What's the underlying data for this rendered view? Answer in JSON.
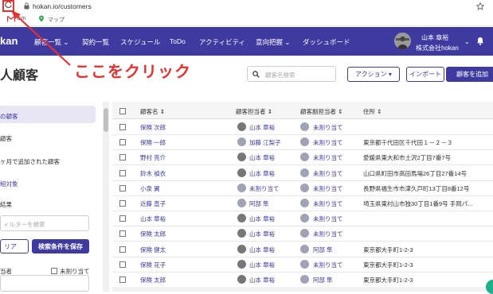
{
  "browser": {
    "url": "hokan.io/customers",
    "bookmarks": [
      {
        "label": "Gm"
      },
      {
        "label": "マップ"
      }
    ]
  },
  "annotation": {
    "text": "ここをクリック"
  },
  "nav": {
    "brand": "kan",
    "items": [
      "顧客一覧 ⌄",
      "契約一覧",
      "スケジュール",
      "ToDo",
      "アクティビティ",
      "意向把握 ⌄",
      "ダッシュボード"
    ],
    "user_name": "山本 章裕",
    "user_org": "株式会社hokan",
    "user_chevron": "⌄"
  },
  "page": {
    "title": "人顧客",
    "search_placeholder": "顧客名検索",
    "action_button": "アクション ▾",
    "import_button": "インポート",
    "add_button": "顧客を追加"
  },
  "left_panel": {
    "item_active": "の顧客",
    "item_2": "顧客",
    "item_3": "ヶ月で追加された顧客",
    "section_link": "組対象",
    "section_results": "結果",
    "filter_placeholder": "ィルターを検索",
    "clear_button": "リア",
    "save_button": "検索条件を保存",
    "assignee_label": "当者",
    "unassigned_label": "未割り当て"
  },
  "table": {
    "headers": [
      "顧客名 ⇕",
      "顧客担当者 ⇕",
      "顧客副担当者 ⇕",
      "住所 ⇕"
    ],
    "rows": [
      {
        "name": "保険 次郎",
        "main": "山本 章裕",
        "main_avatar": "photo",
        "sub": "未割り当て",
        "address": ""
      },
      {
        "name": "保険 一郎",
        "main": "加藤 江梨子",
        "main_avatar": "ghost",
        "sub": "未割り当て",
        "address": "東京都千代田区千代田１－２－３"
      },
      {
        "name": "野村 亮介",
        "main": "山本 章裕",
        "main_avatar": "photo",
        "sub": "未割り当て",
        "address": "愛媛県東大和市土沢2丁目7番7号"
      },
      {
        "name": "鈴木 禎衣",
        "main": "山本 章裕",
        "main_avatar": "photo",
        "sub": "未割り当て",
        "address": "山口県町田市高田馬場26丁目27番14号"
      },
      {
        "name": "小泉 翼",
        "main": "未割り当て",
        "main_avatar": "ghost",
        "sub": "未割り当て",
        "address": "長野県福生市市津久戸町13丁目8番12号"
      },
      {
        "name": "近藤 直子",
        "main": "阿部 隼",
        "main_avatar": "ghost",
        "sub": "未割り当て",
        "address": "埼玉県東村山市独30丁目1番9号 手岡パ..."
      },
      {
        "name": "山本 章裕",
        "main": "山本 章裕",
        "main_avatar": "photo",
        "sub": "未割り当て",
        "address": ""
      },
      {
        "name": "保険 太郎",
        "main": "山本 章裕",
        "main_avatar": "photo",
        "sub": "未割り当て",
        "address": ""
      },
      {
        "name": "保険 健太",
        "main": "山本 章裕",
        "main_avatar": "photo",
        "sub": "阿部 隼",
        "address": "東京都大手町1-2-3"
      },
      {
        "name": "保険 花子",
        "main": "山本 章裕",
        "main_avatar": "photo",
        "sub": "未割り当て",
        "address": "東京都大手町1-2-3"
      },
      {
        "name": "保険 太郎",
        "main": "山本 章裕",
        "main_avatar": "photo",
        "sub": "阿部 隼",
        "address": "東京都大手町1-2-3"
      }
    ]
  },
  "colors": {
    "brand": "#3e3aa0",
    "annotation": "#e8312e",
    "active_bg": "#e8e6f5"
  }
}
